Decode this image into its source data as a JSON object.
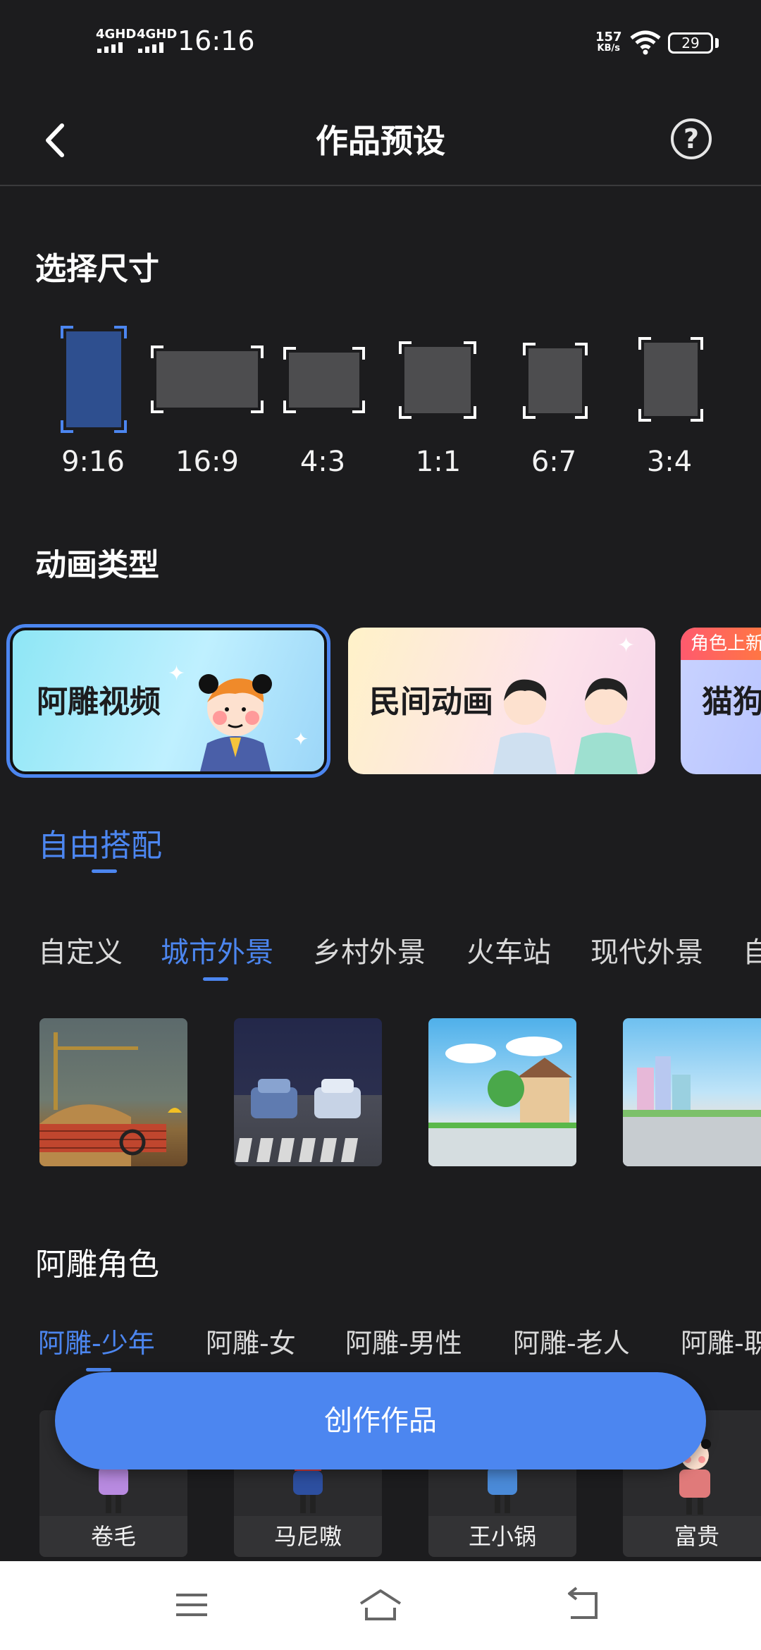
{
  "status_bar": {
    "signal_1": "4GHD",
    "signal_2": "4GHD",
    "time": "16:16",
    "net_speed_value": "157",
    "net_speed_unit": "KB/s",
    "battery": "29"
  },
  "header": {
    "title": "作品预设",
    "help_label": "?"
  },
  "size_section": {
    "title": "选择尺寸",
    "ratios": [
      "9:16",
      "16:9",
      "4:3",
      "1:1",
      "6:7",
      "3:4"
    ],
    "selected": "9:16"
  },
  "animation_section": {
    "title": "动画类型",
    "cards": [
      {
        "label": "阿雕视频",
        "selected": true
      },
      {
        "label": "民间动画",
        "selected": false
      },
      {
        "label": "猫狗",
        "badge": "角色上新",
        "selected": false
      }
    ]
  },
  "free_match": {
    "tab_label": "自由搭配"
  },
  "scene_tabs": {
    "items": [
      "自定义",
      "城市外景",
      "乡村外景",
      "火车站",
      "现代外景",
      "自"
    ],
    "active": "城市外景"
  },
  "character_section": {
    "title": "阿雕角色",
    "tabs": [
      "阿雕-少年",
      "阿雕-女",
      "阿雕-男性",
      "阿雕-老人",
      "阿雕-职"
    ],
    "active_tab": "阿雕-少年",
    "characters": [
      "卷毛",
      "马尼嗷",
      "王小锅",
      "富贵"
    ]
  },
  "create_button": {
    "label": "创作作品"
  },
  "colors": {
    "accent": "#4c86f0",
    "background": "#1c1c1e"
  },
  "icons": {
    "back": "chevron-left-icon",
    "help": "question-circle-icon",
    "nav_menu": "menu-icon",
    "nav_home": "home-icon",
    "nav_back": "back-icon"
  }
}
